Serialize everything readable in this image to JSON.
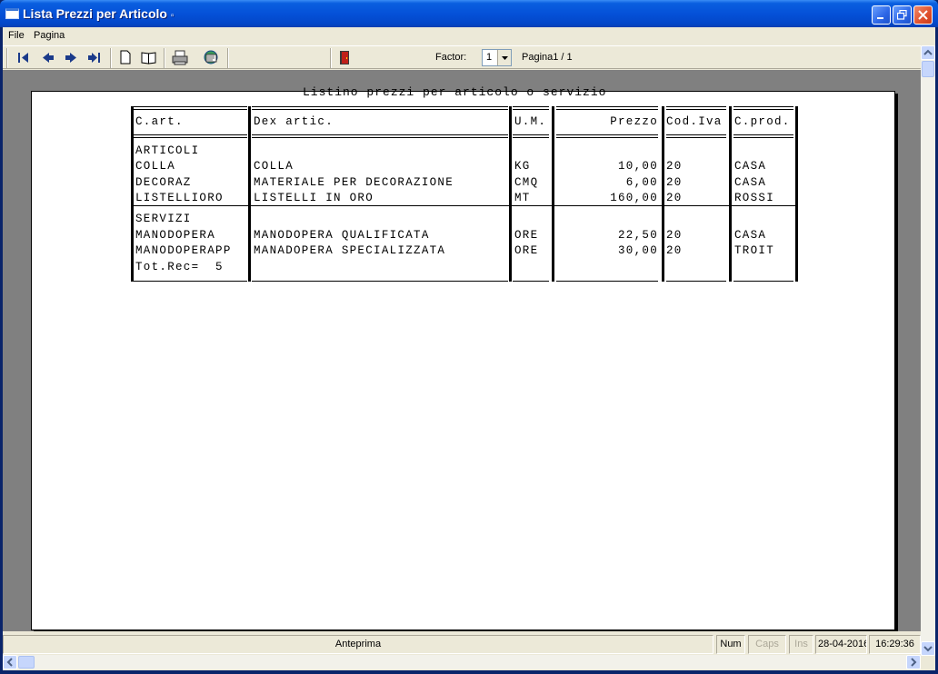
{
  "window": {
    "title": "Lista Prezzi per Articolo",
    "title_suffix": "▫"
  },
  "menu": {
    "file": "File",
    "pagina": "Pagina"
  },
  "toolbar": {
    "factor_label": "Factor:",
    "factor_value": "1",
    "page_info": "Pagina1 / 1",
    "icons": [
      "first-page-icon",
      "prev-page-icon",
      "next-page-icon",
      "last-page-icon",
      "single-page-icon",
      "two-pages-icon",
      "print-icon",
      "export-icon",
      "exit-door-icon"
    ]
  },
  "report": {
    "title": "Listino prezzi per articolo o servizio",
    "columns": [
      "C.art.",
      "Dex artic.",
      "U.M.",
      "Prezzo",
      "Cod.Iva",
      "C.prod."
    ],
    "groups": [
      {
        "name": "ARTICOLI",
        "rows": [
          {
            "code": "COLLA",
            "desc": "COLLA",
            "um": "KG",
            "price": "10,00",
            "iva": "20",
            "prod": "CASA"
          },
          {
            "code": "DECORAZ",
            "desc": "MATERIALE PER DECORAZIONE",
            "um": "CMQ",
            "price": "6,00",
            "iva": "20",
            "prod": "CASA"
          },
          {
            "code": "LISTELLIORO",
            "desc": "LISTELLI IN ORO",
            "um": "MT",
            "price": "160,00",
            "iva": "20",
            "prod": "ROSSI"
          }
        ]
      },
      {
        "name": "SERVIZI",
        "rows": [
          {
            "code": "MANODOPERA",
            "desc": "MANODOPERA QUALIFICATA",
            "um": "ORE",
            "price": "22,50",
            "iva": "20",
            "prod": "CASA"
          },
          {
            "code": "MANODOPERAPP",
            "desc": "MANADOPERA SPECIALIZZATA",
            "um": "ORE",
            "price": "30,00",
            "iva": "20",
            "prod": "TROIT"
          }
        ]
      }
    ],
    "total": "Tot.Rec=  5"
  },
  "status": {
    "mode": "Anteprima",
    "num": "Num",
    "caps": "Caps",
    "ins": "Ins",
    "date": "28-04-2016",
    "time": "16:29:36"
  },
  "colors": {
    "title_blue": "#0551d8",
    "preview_gray": "#808080",
    "face": "#ece9d8"
  }
}
